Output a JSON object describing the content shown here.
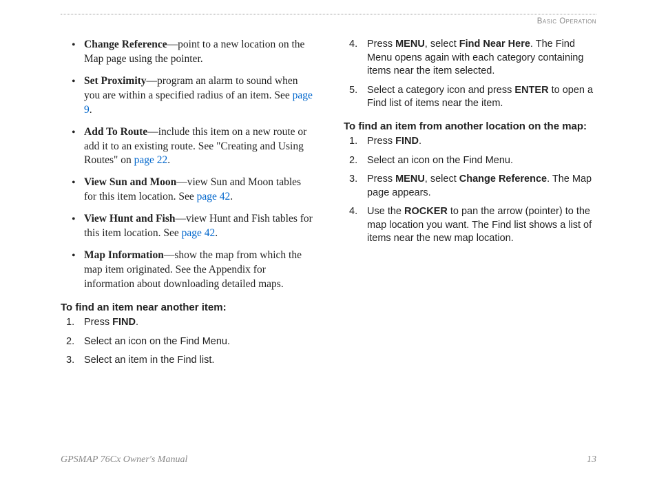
{
  "header": "Basic Operation",
  "left": {
    "bullets": [
      {
        "title": "Change Reference",
        "desc": "—point to a new location on the Map page using the pointer."
      },
      {
        "title": "Set Proximity",
        "desc_a": "—program an alarm to sound when you are within a specified radius of an item. See ",
        "link": "page 9",
        "desc_b": "."
      },
      {
        "title": "Add To Route",
        "desc_a": "—include this item on a new route or add it to an existing route. See \"Creating and Using Routes\" on ",
        "link": "page 22",
        "desc_b": "."
      },
      {
        "title": "View Sun and Moon",
        "desc_a": "—view Sun and Moon tables for this item location. See ",
        "link": "page 42",
        "desc_b": "."
      },
      {
        "title": "View Hunt and Fish",
        "desc_a": "—view Hunt and Fish tables for this item location. See ",
        "link": "page 42",
        "desc_b": "."
      },
      {
        "title": "Map Information",
        "desc": "—show the map from which the map item originated. See the Appendix for information about downloading detailed maps."
      }
    ],
    "heading1": "To find an item near another item:",
    "steps1": [
      {
        "n": "1.",
        "pre": "Press ",
        "key": "FIND",
        "post": "."
      },
      {
        "n": "2.",
        "text": "Select an icon on the Find Menu."
      },
      {
        "n": "3.",
        "text": "Select an item in the Find list."
      }
    ]
  },
  "right": {
    "steps_cont": [
      {
        "n": "4.",
        "pre": "Press ",
        "key1": "MENU",
        "mid": ", select ",
        "key2": "Find Near Here",
        "post": ". The Find Menu opens again with each category containing items near the item selected."
      },
      {
        "n": "5.",
        "pre": "Select a category icon and press ",
        "key1": "ENTER",
        "post": " to open a Find list of items near the item."
      }
    ],
    "heading2": "To find an item from another location on the map:",
    "steps2": [
      {
        "n": "1.",
        "pre": "Press ",
        "key": "FIND",
        "post": "."
      },
      {
        "n": "2.",
        "text": "Select an icon on the Find Menu."
      },
      {
        "n": "3.",
        "pre": "Press ",
        "key1": "MENU",
        "mid": ", select ",
        "key2": "Change Reference",
        "post": ". The Map page appears."
      },
      {
        "n": "4.",
        "pre": "Use the ",
        "key1": "ROCKER",
        "post": " to pan the arrow (pointer) to the map location you want. The Find list shows a list of items near the new map location."
      }
    ]
  },
  "footer": {
    "left": "GPSMAP 76Cx Owner's Manual",
    "right": "13"
  }
}
